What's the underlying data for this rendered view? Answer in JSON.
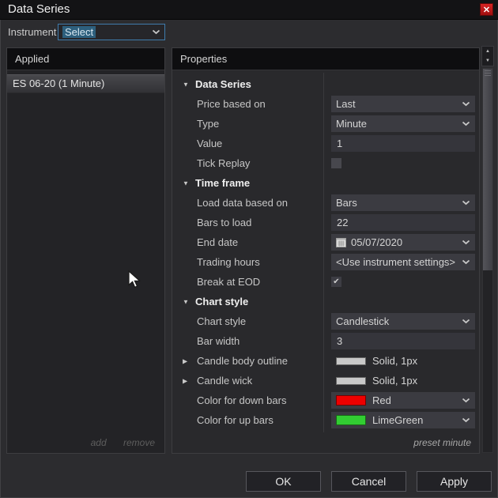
{
  "window": {
    "title": "Data Series"
  },
  "instrument": {
    "label": "Instrument",
    "value": "Select"
  },
  "applied_panel": {
    "header": "Applied",
    "items": [
      "ES 06-20 (1 Minute)"
    ],
    "add_label": "add",
    "remove_label": "remove"
  },
  "properties_panel": {
    "header": "Properties",
    "preset_label": "preset minute",
    "rows": [
      {
        "type": "category",
        "label": "Data Series"
      },
      {
        "type": "combo",
        "label": "Price based on",
        "value": "Last"
      },
      {
        "type": "combo",
        "label": "Type",
        "value": "Minute"
      },
      {
        "type": "input",
        "label": "Value",
        "value": "1"
      },
      {
        "type": "checkbox",
        "label": "Tick Replay",
        "checked": false
      },
      {
        "type": "category",
        "label": "Time frame"
      },
      {
        "type": "combo",
        "label": "Load data based on",
        "value": "Bars"
      },
      {
        "type": "input",
        "label": "Bars to load",
        "value": "22"
      },
      {
        "type": "date",
        "label": "End date",
        "value": "05/07/2020"
      },
      {
        "type": "combo",
        "label": "Trading hours",
        "value": "<Use instrument settings>"
      },
      {
        "type": "checkbox",
        "label": "Break at EOD",
        "checked": true
      },
      {
        "type": "category",
        "label": "Chart style"
      },
      {
        "type": "combo",
        "label": "Chart style",
        "value": "Candlestick"
      },
      {
        "type": "input",
        "label": "Bar width",
        "value": "3"
      },
      {
        "type": "swatch",
        "label": "Candle body outline",
        "value": "Solid, 1px",
        "swatch": "#c8c8c8"
      },
      {
        "type": "swatch",
        "label": "Candle wick",
        "value": "Solid, 1px",
        "swatch": "#c8c8c8"
      },
      {
        "type": "colorcombo",
        "label": "Color for down bars",
        "value": "Red",
        "swatch": "#ee0000"
      },
      {
        "type": "colorcombo",
        "label": "Color for up bars",
        "value": "LimeGreen",
        "swatch": "#32cd32"
      }
    ]
  },
  "buttons": {
    "ok": "OK",
    "cancel": "Cancel",
    "apply": "Apply"
  },
  "icons": {
    "close": "✕",
    "checkmark": "✔",
    "collapse_triangle": "▼",
    "expand_triangle": "▶",
    "scroll_up": "▲",
    "scroll_down": "▼"
  },
  "colors": {
    "accent_blue_border": "#3f7cad",
    "selection_blue": "#2d5f7d",
    "close_red": "#c01515",
    "down_bar_red": "#ee0000",
    "up_bar_limegreen": "#32cd32",
    "line_silver": "#c8c8c8"
  }
}
